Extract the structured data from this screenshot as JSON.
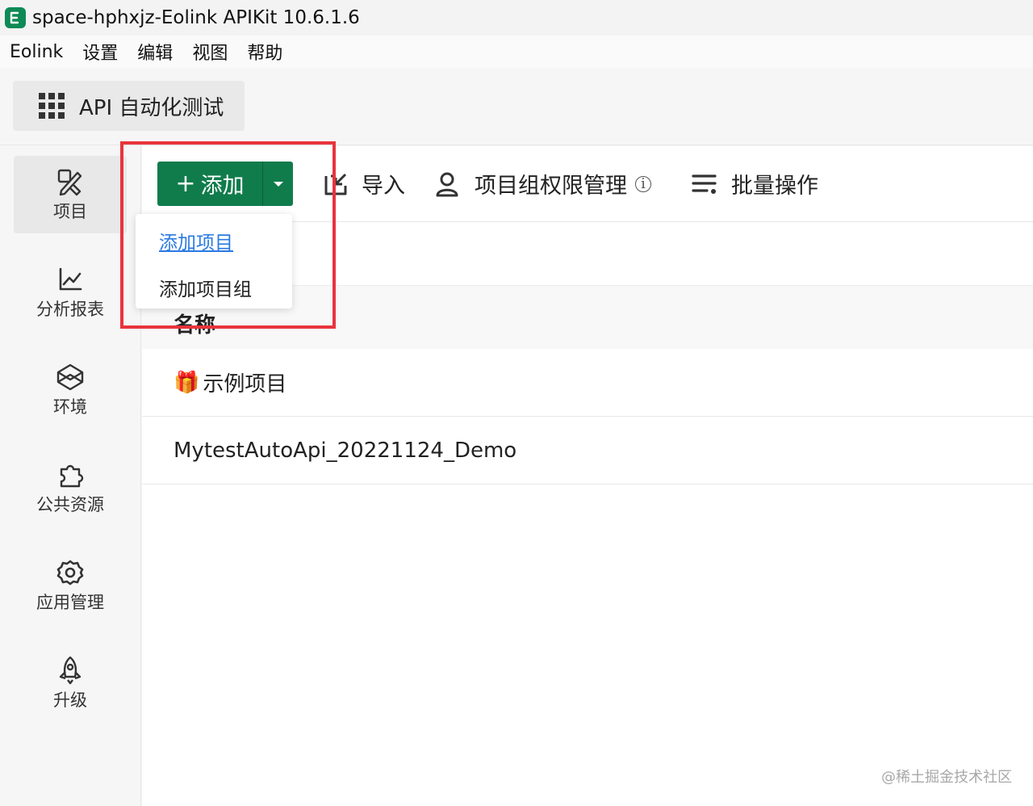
{
  "window": {
    "title": "space-hphxjz-Eolink APIKit 10.6.1.6"
  },
  "menubar": {
    "items": [
      "Eolink",
      "设置",
      "编辑",
      "视图",
      "帮助"
    ]
  },
  "module": {
    "label": "API 自动化测试",
    "icon": "grid-icon"
  },
  "sidebar": {
    "items": [
      {
        "label": "项目",
        "icon": "project-icon",
        "active": true
      },
      {
        "label": "分析报表",
        "icon": "chart-icon",
        "active": false
      },
      {
        "label": "环境",
        "icon": "environment-icon",
        "active": false
      },
      {
        "label": "公共资源",
        "icon": "puzzle-icon",
        "active": false
      },
      {
        "label": "应用管理",
        "icon": "gear-icon",
        "active": false
      },
      {
        "label": "升级",
        "icon": "rocket-icon",
        "active": false
      }
    ]
  },
  "toolbar": {
    "add_label": "添加",
    "import_label": "导入",
    "permission_label": "项目组权限管理",
    "batch_label": "批量操作"
  },
  "dropdown": {
    "items": [
      "添加项目",
      "添加项目组"
    ],
    "hovered_index": 0
  },
  "table": {
    "header_name": "名称",
    "rows": [
      {
        "name": "示例项目",
        "icon": "gift-icon"
      },
      {
        "name": "MytestAutoApi_20221124_Demo"
      }
    ]
  },
  "watermark": "@稀土掘金技术社区",
  "colors": {
    "accent": "#107c4c",
    "highlight": "#e8343c",
    "link": "#2a7ae2"
  }
}
